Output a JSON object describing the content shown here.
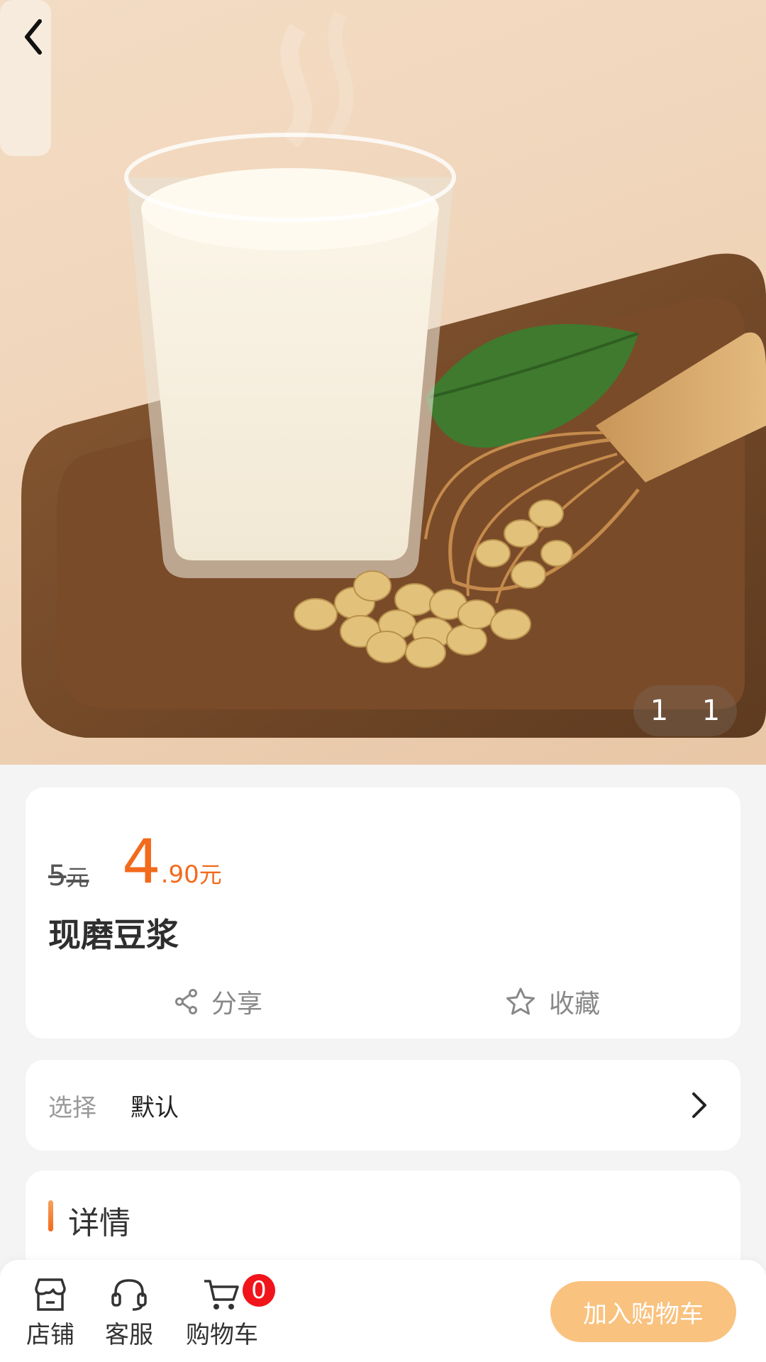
{
  "hero": {
    "image_alt": "soy milk glass on wooden tray",
    "counter": {
      "current": "1",
      "total": "1"
    }
  },
  "product": {
    "original_price": "5",
    "original_unit": "元",
    "price_integer": "4",
    "price_decimal": ".90",
    "price_unit": "元",
    "name": "现磨豆浆",
    "share_label": "分享",
    "favorite_label": "收藏"
  },
  "selection": {
    "label": "选择",
    "value": "默认"
  },
  "detail": {
    "title": "详情"
  },
  "bottom_bar": {
    "shop_label": "店铺",
    "service_label": "客服",
    "cart_label": "购物车",
    "cart_count": "0",
    "add_to_cart_label": "加入购物车"
  },
  "colors": {
    "accent": "#f26a1b",
    "add_to_cart_bg": "#f9c27f",
    "badge": "#f2141b",
    "page_bg": "#f4f4f4"
  },
  "icons": {
    "back": "chevron-left-icon",
    "share": "share-icon",
    "favorite": "star-outline-icon",
    "arrow": "chevron-right-icon",
    "shop": "store-icon",
    "service": "headset-icon",
    "cart": "cart-icon"
  }
}
